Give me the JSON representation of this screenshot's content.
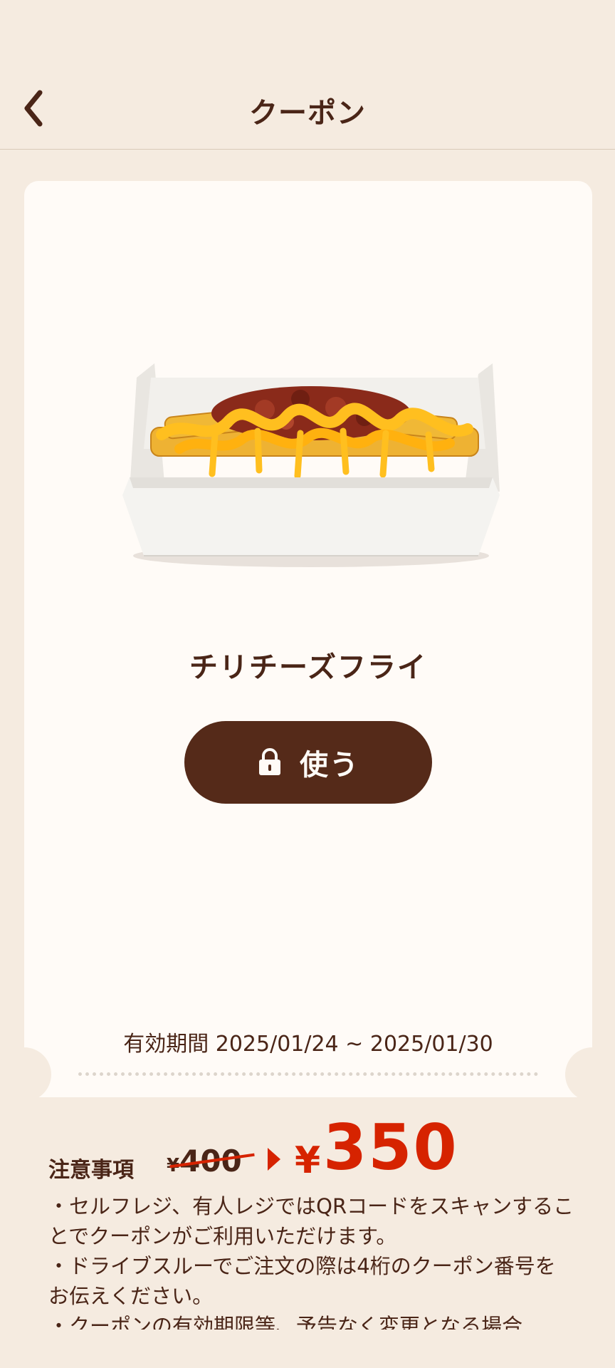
{
  "header": {
    "title": "クーポン",
    "back_icon": "chevron-left-icon"
  },
  "coupon": {
    "product_name": "チリチーズフライ",
    "use_button_label": "使う",
    "use_button_icon": "lock-icon",
    "old_price_symbol": "¥",
    "old_price": "400",
    "new_price_symbol": "¥",
    "new_price": "350",
    "validity": "有効期間 2025/01/24 ~ 2025/01/30"
  },
  "notes": {
    "title": "注意事項",
    "items": [
      "・セルフレジ、有人レジではQRコードをスキャンすることでクーポンがご利用いただけます。",
      "・ドライブスルーでご注文の際は4桁のクーポン番号をお伝えください。",
      "・クーポンの有効期限等、予告なく変更となる場合"
    ]
  },
  "colors": {
    "background": "#f5ebe0",
    "card": "#fffbf7",
    "brown": "#4a2517",
    "button": "#552a19",
    "red": "#d62300"
  }
}
